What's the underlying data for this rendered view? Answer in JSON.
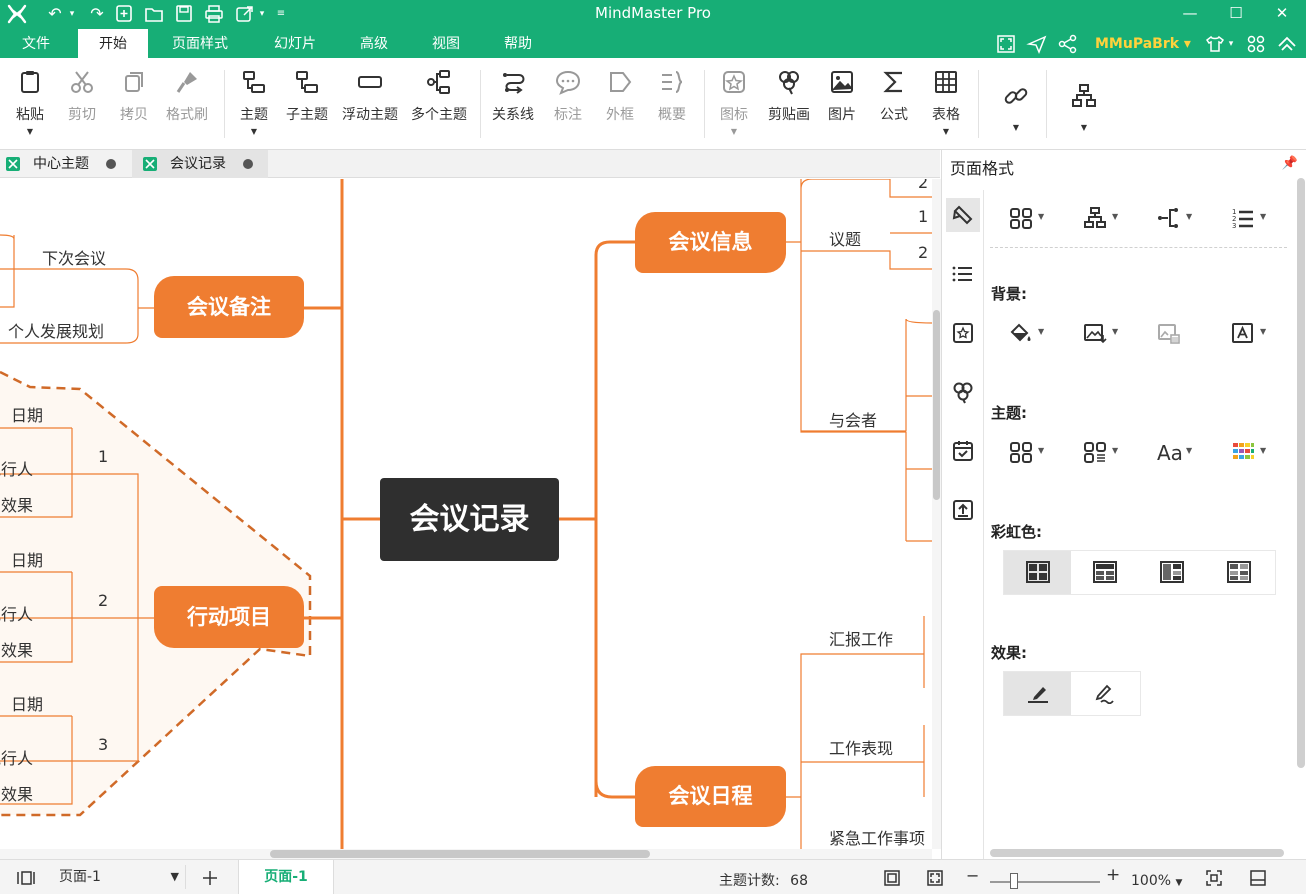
{
  "app": {
    "title": "MindMaster Pro",
    "brand_color": "#17ae76",
    "accent_orange": "#ef7d31",
    "username": "MMuPaBrk"
  },
  "window_controls": {
    "minimize": "—",
    "maximize": "☐",
    "close": "✕"
  },
  "menu": {
    "items": [
      "文件",
      "开始",
      "页面样式",
      "幻灯片",
      "高级",
      "视图",
      "帮助"
    ],
    "active": "开始"
  },
  "ribbon": {
    "buttons": [
      {
        "label": "粘贴",
        "icon": "paste-icon",
        "enabled": true
      },
      {
        "label": "剪切",
        "icon": "scissors-icon",
        "enabled": false
      },
      {
        "label": "拷贝",
        "icon": "copy-icon",
        "enabled": false
      },
      {
        "label": "格式刷",
        "icon": "format-brush-icon",
        "enabled": false
      },
      {
        "label": "主题",
        "icon": "topic-icon",
        "enabled": true
      },
      {
        "label": "子主题",
        "icon": "subtopic-icon",
        "enabled": true
      },
      {
        "label": "浮动主题",
        "icon": "floating-topic-icon",
        "enabled": true
      },
      {
        "label": "多个主题",
        "icon": "multiple-topics-icon",
        "enabled": true
      },
      {
        "label": "关系线",
        "icon": "relationship-icon",
        "enabled": true
      },
      {
        "label": "标注",
        "icon": "callout-icon",
        "enabled": false
      },
      {
        "label": "外框",
        "icon": "boundary-icon",
        "enabled": false
      },
      {
        "label": "概要",
        "icon": "summary-icon",
        "enabled": false
      },
      {
        "label": "图标",
        "icon": "mark-icon",
        "enabled": false
      },
      {
        "label": "剪贴画",
        "icon": "clipart-icon",
        "enabled": true
      },
      {
        "label": "图片",
        "icon": "picture-icon",
        "enabled": true
      },
      {
        "label": "公式",
        "icon": "formula-icon",
        "enabled": true
      },
      {
        "label": "表格",
        "icon": "table-icon",
        "enabled": true
      }
    ]
  },
  "doc_tabs": [
    {
      "label": "中心主题",
      "active": false
    },
    {
      "label": "会议记录",
      "active": true
    }
  ],
  "mindmap": {
    "central": "会议记录",
    "left_branches": [
      {
        "label": "会议备注",
        "children": [
          "下次会议",
          "个人发展规划"
        ]
      },
      {
        "label": "行动项目",
        "numbers": [
          "1",
          "2",
          "3"
        ],
        "child_labels": [
          "日期",
          "执行人",
          "预期效果"
        ]
      }
    ],
    "right_branches": [
      {
        "label": "会议信息",
        "children": [
          "议题",
          "与会者"
        ],
        "sub_numbers": [
          "2",
          "1",
          "2"
        ]
      },
      {
        "label": "会议日程",
        "children": [
          "汇报工作",
          "工作表现",
          "紧急工作事项"
        ]
      }
    ]
  },
  "panel": {
    "title": "页面格式",
    "sections": {
      "background": "背景:",
      "theme": "主题:",
      "rainbow": "彩虹色:",
      "effects": "效果:"
    }
  },
  "status": {
    "page_select": "页面-1",
    "page_tab": "页面-1",
    "count_label": "主题计数:",
    "count_value": "68",
    "zoom": "100%"
  }
}
